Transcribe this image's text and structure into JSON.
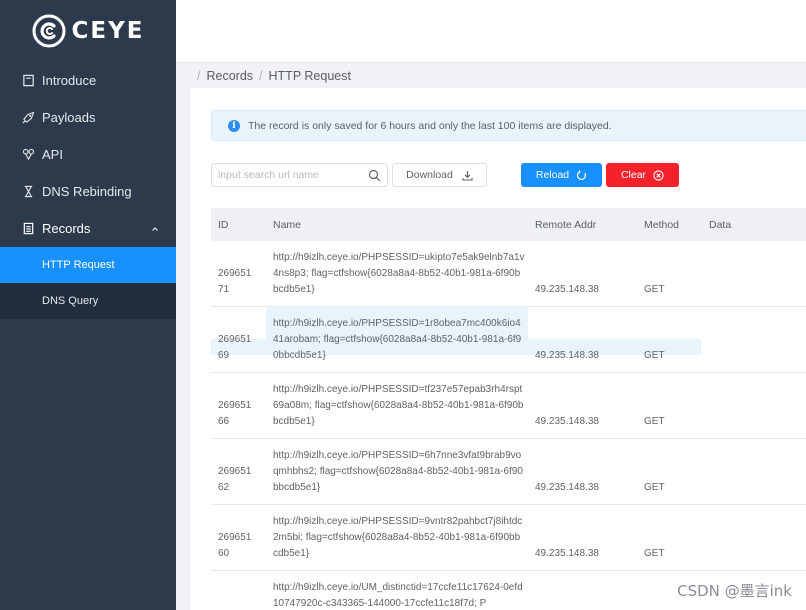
{
  "brand": {
    "name": "CEYE"
  },
  "sidebar": {
    "items": [
      {
        "label": "Introduce",
        "icon": "document-icon"
      },
      {
        "label": "Payloads",
        "icon": "rocket-icon"
      },
      {
        "label": "API",
        "icon": "api-icon"
      },
      {
        "label": "DNS Rebinding",
        "icon": "hourglass-icon"
      },
      {
        "label": "Records",
        "icon": "records-icon"
      }
    ],
    "sub_items": [
      {
        "label": "HTTP Request",
        "active": true
      },
      {
        "label": "DNS Query",
        "active": false
      }
    ]
  },
  "breadcrumb": {
    "root": "Records",
    "current": "HTTP Request"
  },
  "alert": {
    "text": "The record is only saved for 6 hours and only the last 100 items are displayed."
  },
  "toolbar": {
    "search_placeholder": "input search url name",
    "download_label": "Download",
    "reload_label": "Reload",
    "clear_label": "Clear"
  },
  "table": {
    "columns": [
      "ID",
      "Name",
      "Remote Addr",
      "Method",
      "Data"
    ],
    "rows": [
      {
        "id_line1": "269651",
        "id_line2": "71",
        "name": "http://h9izlh.ceye.io/PHPSESSID=ukipto7e5ak9elnb7a1v4ns8p3; flag=ctfshow{6028a8a4-8b52-40b1-981a-6f90bbcdb5e1}",
        "addr": "49.235.148.38",
        "method": "GET"
      },
      {
        "id_line1": "269651",
        "id_line2": "69",
        "name": "http://h9izlh.ceye.io/PHPSESSID=1r8obea7mc400k6io441arobam; flag=ctfshow{6028a8a4-8b52-40b1-981a-6f90bbcdb5e1}",
        "addr": "49.235.148.38",
        "method": "GET"
      },
      {
        "id_line1": "269651",
        "id_line2": "66",
        "name": "http://h9izlh.ceye.io/PHPSESSID=tf237e57epab3rh4rspt69a08m; flag=ctfshow{6028a8a4-8b52-40b1-981a-6f90bbcdb5e1}",
        "addr": "49.235.148.38",
        "method": "GET"
      },
      {
        "id_line1": "269651",
        "id_line2": "62",
        "name": "http://h9izlh.ceye.io/PHPSESSID=6h7nne3vfat9brab9voqmhbhs2; flag=ctfshow{6028a8a4-8b52-40b1-981a-6f90bbcdb5e1}",
        "addr": "49.235.148.38",
        "method": "GET"
      },
      {
        "id_line1": "269651",
        "id_line2": "60",
        "name": "http://h9izlh.ceye.io/PHPSESSID=9vntr82pahbct7j8ihtdc2m5bi; flag=ctfshow{6028a8a4-8b52-40b1-981a-6f90bbcdb5e1}",
        "addr": "49.235.148.38",
        "method": "GET"
      },
      {
        "id_line1": "",
        "id_line2": "",
        "name": "http://h9izlh.ceye.io/UM_distinctid=17ccfe11c17624-0efd10747920c-c343365-144000-17ccfe11c18f7d; P",
        "addr": "",
        "method": ""
      }
    ]
  },
  "watermark": "CSDN @墨言ink",
  "colors": {
    "sidebar": "#2d3a4b",
    "submenu": "#1f2d3d",
    "primary": "#1890ff",
    "danger": "#f5222d",
    "info_bg": "#e9f3fb"
  }
}
